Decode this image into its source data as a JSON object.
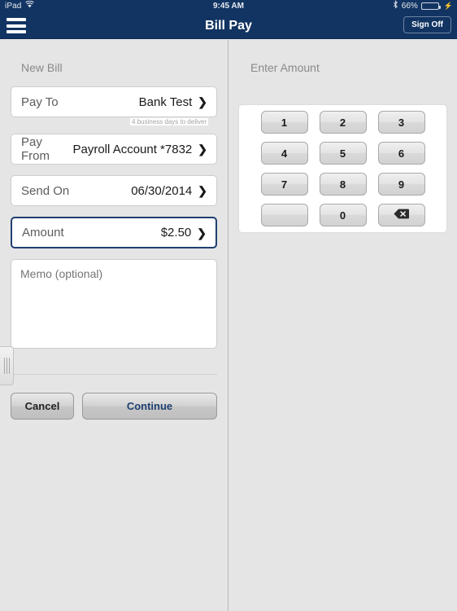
{
  "statusbar": {
    "device": "iPad",
    "wifi_icon": "wifi-icon",
    "time": "9:45 AM",
    "bluetooth_icon": "bluetooth-icon",
    "battery_percent": "66%",
    "battery_icon": "battery-icon",
    "charging_icon": "lightning-bolt-icon"
  },
  "navbar": {
    "menu_icon": "hamburger-menu-icon",
    "title": "Bill Pay",
    "signoff_label": "Sign Off"
  },
  "left_panel": {
    "header": "New Bill",
    "drag_handle_icon": "drag-handle-icon",
    "fields": [
      {
        "label": "Pay To",
        "value": "Bank Test",
        "note": "4 business days to deliver",
        "chevron": "chevron-right-icon",
        "selected": false
      },
      {
        "label": "Pay From",
        "value": "Payroll Account *7832",
        "note": "",
        "chevron": "chevron-right-icon",
        "selected": false
      },
      {
        "label": "Send On",
        "value": "06/30/2014",
        "note": "",
        "chevron": "chevron-right-icon",
        "selected": false
      },
      {
        "label": "Amount",
        "value": "$2.50",
        "note": "",
        "chevron": "chevron-right-icon",
        "selected": true
      }
    ],
    "memo_placeholder": "Memo (optional)",
    "memo_value": "",
    "cancel_label": "Cancel",
    "continue_label": "Continue"
  },
  "right_panel": {
    "header": "Enter Amount",
    "keys": [
      {
        "label": "1",
        "name": "keypad-key-1"
      },
      {
        "label": "2",
        "name": "keypad-key-2"
      },
      {
        "label": "3",
        "name": "keypad-key-3"
      },
      {
        "label": "4",
        "name": "keypad-key-4"
      },
      {
        "label": "5",
        "name": "keypad-key-5"
      },
      {
        "label": "6",
        "name": "keypad-key-6"
      },
      {
        "label": "7",
        "name": "keypad-key-7"
      },
      {
        "label": "8",
        "name": "keypad-key-8"
      },
      {
        "label": "9",
        "name": "keypad-key-9"
      },
      {
        "label": "",
        "name": "keypad-key-blank"
      },
      {
        "label": "0",
        "name": "keypad-key-0"
      },
      {
        "label": "",
        "name": "keypad-key-backspace",
        "icon": "backspace-icon"
      }
    ]
  },
  "colors": {
    "navy": "#123462",
    "panel_bg": "#e5e5e5",
    "accent_blue": "#1f3f70",
    "battery_green": "#4cd964"
  }
}
